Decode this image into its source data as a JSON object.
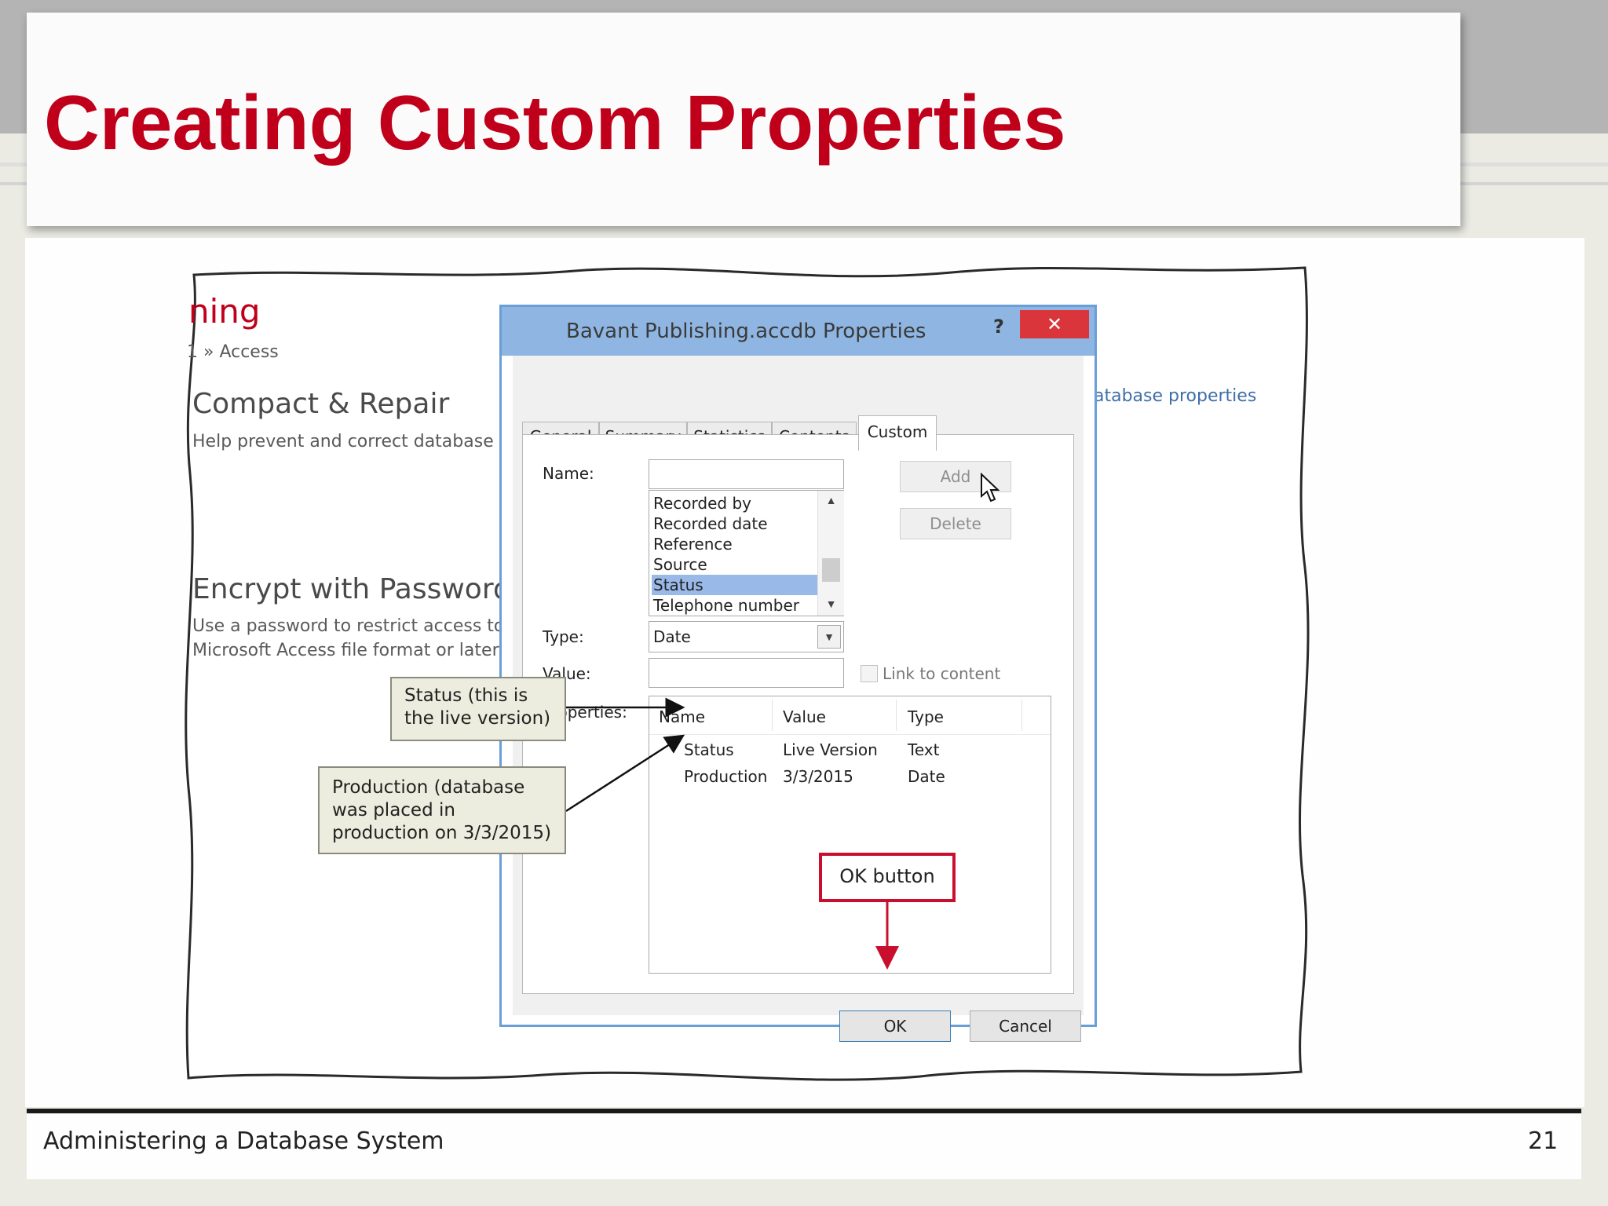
{
  "slide": {
    "title": "Creating Custom Properties",
    "footer_left": "Administering a Database System",
    "page_number": "21"
  },
  "background": {
    "heading_fragment": "ning",
    "breadcrumb": "1 » Access",
    "compact_title": "Compact & Repair",
    "compact_desc": "Help prevent and correct database file",
    "encrypt_title": "Encrypt with Password",
    "encrypt_desc_1": "Use a password to restrict access to yo",
    "encrypt_desc_2": "Microsoft Access file format or later a",
    "right_link": "atabase properties"
  },
  "dialog": {
    "title": "Bavant Publishing.accdb Properties",
    "help_label": "?",
    "close_label": "✕",
    "tabs": [
      {
        "label": "General"
      },
      {
        "label": "Summary"
      },
      {
        "label": "Statistics"
      },
      {
        "label": "Contents"
      },
      {
        "label": "Custom"
      }
    ],
    "active_tab": "Custom",
    "name_label": "Name:",
    "name_value": "",
    "name_options": [
      "Recorded by",
      "Recorded date",
      "Reference",
      "Source",
      "Status",
      "Telephone number"
    ],
    "selected_option": "Status",
    "add_label": "Add",
    "delete_label": "Delete",
    "type_label": "Type:",
    "type_value": "Date",
    "value_label": "Value:",
    "value_value": "",
    "link_label": "Link to content",
    "link_checked": false,
    "properties_label": "Properties:",
    "table_headers": [
      "Name",
      "Value",
      "Type"
    ],
    "table_rows": [
      {
        "name": "Status",
        "value": "Live Version",
        "type": "Text"
      },
      {
        "name": "Production",
        "value": "3/3/2015",
        "type": "Date"
      }
    ],
    "ok_label": "OK",
    "cancel_label": "Cancel"
  },
  "callouts": {
    "status_line1": "Status (this is",
    "status_line2": "the live version)",
    "production_line1": "Production (database",
    "production_line2": "was placed in",
    "production_line3": "production on 3/3/2015)",
    "ok_button": "OK button"
  },
  "colors": {
    "title_red": "#c0001b",
    "dialog_title_blue": "#8fb6e2",
    "close_red": "#d9353a",
    "selection_blue": "#99b9e8",
    "callout_red": "#c8102e",
    "callout_fill": "#ededdf"
  }
}
